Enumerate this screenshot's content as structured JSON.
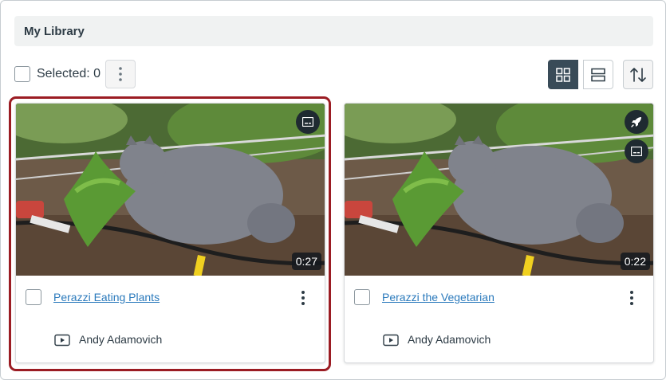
{
  "library": {
    "title": "My Library"
  },
  "toolbar": {
    "selected_label": "Selected: 0",
    "icons": {
      "more": "vertical-dots-icon",
      "grid_view": "grid-view-icon",
      "list_view": "list-view-icon",
      "sort": "sort-arrows-icon"
    },
    "active_view": "grid"
  },
  "media": [
    {
      "title": "Perazzi Eating Plants",
      "duration": "0:27",
      "owner": "Andy Adamovich",
      "badges": [
        "captions-icon"
      ],
      "selected": false,
      "highlighted": true
    },
    {
      "title": "Perazzi the Vegetarian",
      "duration": "0:22",
      "owner": "Andy Adamovich",
      "badges": [
        "rocket-icon",
        "captions-icon"
      ],
      "selected": false,
      "highlighted": false
    }
  ],
  "colors": {
    "highlight": "#9b1c23",
    "link": "#2b7abc",
    "active_toggle": "#394b58",
    "header_bg": "#f0f2f2"
  }
}
